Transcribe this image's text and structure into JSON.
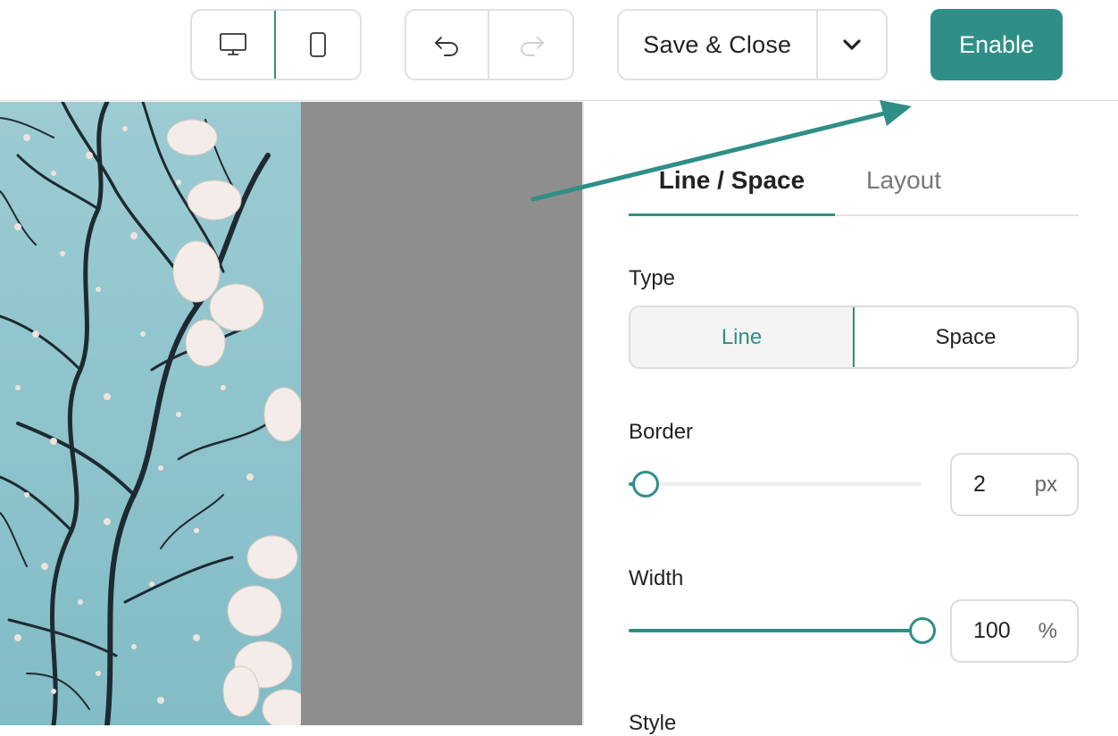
{
  "toolbar": {
    "device_buttons": [
      {
        "name": "desktop-view-button",
        "icon": "monitor-icon",
        "active": true
      },
      {
        "name": "mobile-view-button",
        "icon": "phone-icon",
        "active": false
      }
    ],
    "history_buttons": [
      {
        "name": "undo-button",
        "icon": "undo-icon",
        "enabled": true
      },
      {
        "name": "redo-button",
        "icon": "redo-icon",
        "enabled": false
      }
    ],
    "save_label": "Save & Close",
    "save_menu_icon": "chevron-down-icon",
    "enable_label": "Enable"
  },
  "colors": {
    "accent": "#2f8f86",
    "canvas_gray": "#8e8e8e",
    "sky": "#8fc4cc"
  },
  "panel": {
    "tabs": [
      {
        "label": "Line / Space",
        "active": true
      },
      {
        "label": "Layout",
        "active": false
      }
    ],
    "type": {
      "label": "Type",
      "options": [
        "Line",
        "Space"
      ],
      "selected": "Line"
    },
    "border": {
      "label": "Border",
      "value": "2",
      "unit": "px",
      "slider_fraction": 0.03
    },
    "width": {
      "label": "Width",
      "value": "100",
      "unit": "%",
      "slider_fraction": 1.0
    },
    "style": {
      "label": "Style"
    }
  }
}
